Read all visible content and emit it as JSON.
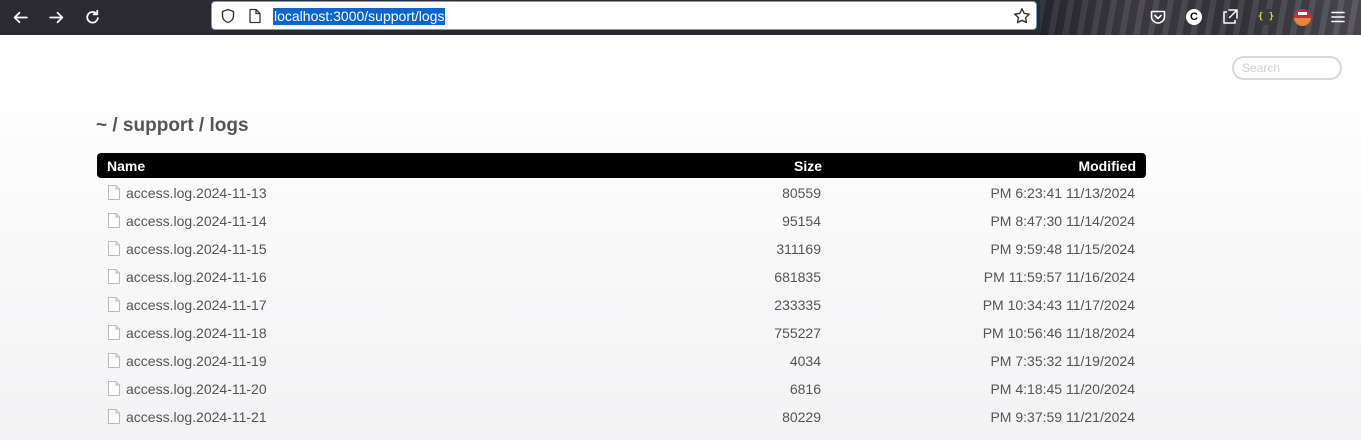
{
  "browser": {
    "url": "localhost:3000/support/logs",
    "icons": [
      "back-arrow-icon",
      "forward-arrow-icon",
      "reload-icon",
      "shield-icon",
      "page-icon",
      "bookmark-star-icon",
      "pocket-icon",
      "c-extension-icon",
      "share-icon",
      "json-braces-icon",
      "avatar-extension-icon",
      "menu-icon"
    ],
    "ext_c_label": "C",
    "ext_braces_label": "{ }"
  },
  "search": {
    "placeholder": "Search",
    "value": ""
  },
  "breadcrumb": "~ / support / logs",
  "table": {
    "headers": {
      "name": "Name",
      "size": "Size",
      "modified": "Modified"
    },
    "rows": [
      {
        "name": "access.log.2024-11-13",
        "size": "80559",
        "modified": "PM 6:23:41 11/13/2024"
      },
      {
        "name": "access.log.2024-11-14",
        "size": "95154",
        "modified": "PM 8:47:30 11/14/2024"
      },
      {
        "name": "access.log.2024-11-15",
        "size": "311169",
        "modified": "PM 9:59:48 11/15/2024"
      },
      {
        "name": "access.log.2024-11-16",
        "size": "681835",
        "modified": "PM 11:59:57 11/16/2024"
      },
      {
        "name": "access.log.2024-11-17",
        "size": "233335",
        "modified": "PM 10:34:43 11/17/2024"
      },
      {
        "name": "access.log.2024-11-18",
        "size": "755227",
        "modified": "PM 10:56:46 11/18/2024"
      },
      {
        "name": "access.log.2024-11-19",
        "size": "4034",
        "modified": "PM 7:35:32 11/19/2024"
      },
      {
        "name": "access.log.2024-11-20",
        "size": "6816",
        "modified": "PM 4:18:45 11/20/2024"
      },
      {
        "name": "access.log.2024-11-21",
        "size": "80229",
        "modified": "PM 9:37:59 11/21/2024"
      }
    ]
  },
  "colors": {
    "header_bg": "#000000",
    "text": "#555555",
    "url_highlight": "#0a64d4",
    "chrome_bg": "#2b2a33"
  }
}
